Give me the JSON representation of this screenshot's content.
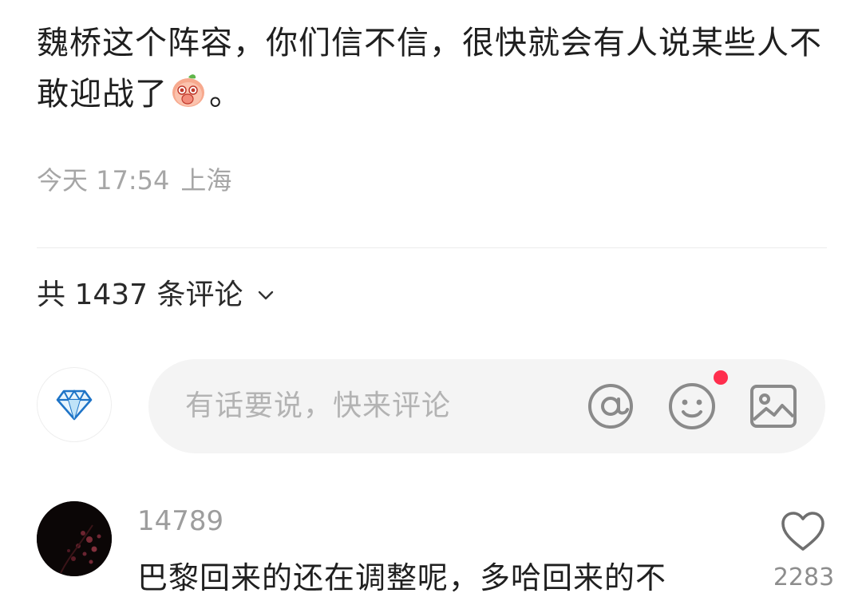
{
  "post": {
    "text_part1": "魏桥这个阵容，你们信不信，很快就会有人说某些人不敢迎战了",
    "emoji_name": "peach-cover-mouth-emoji",
    "text_end": "。",
    "time": "今天 17:54",
    "location": "上海"
  },
  "comments_header": {
    "count_label": "共 1437 条评论"
  },
  "composer": {
    "placeholder": "有话要说，快来评论",
    "avatar_icon": "diamond-icon",
    "icons": [
      "at-icon",
      "emoji-icon",
      "image-icon"
    ],
    "has_new_emoji": true
  },
  "comments": [
    {
      "username": "14789",
      "text": "巴黎回来的还在调整呢，多哈回来的不",
      "likes": "2283"
    }
  ],
  "colors": {
    "accent_red": "#ff2e4d",
    "muted_text": "#a6a6a6",
    "input_bg": "#f4f4f4"
  }
}
